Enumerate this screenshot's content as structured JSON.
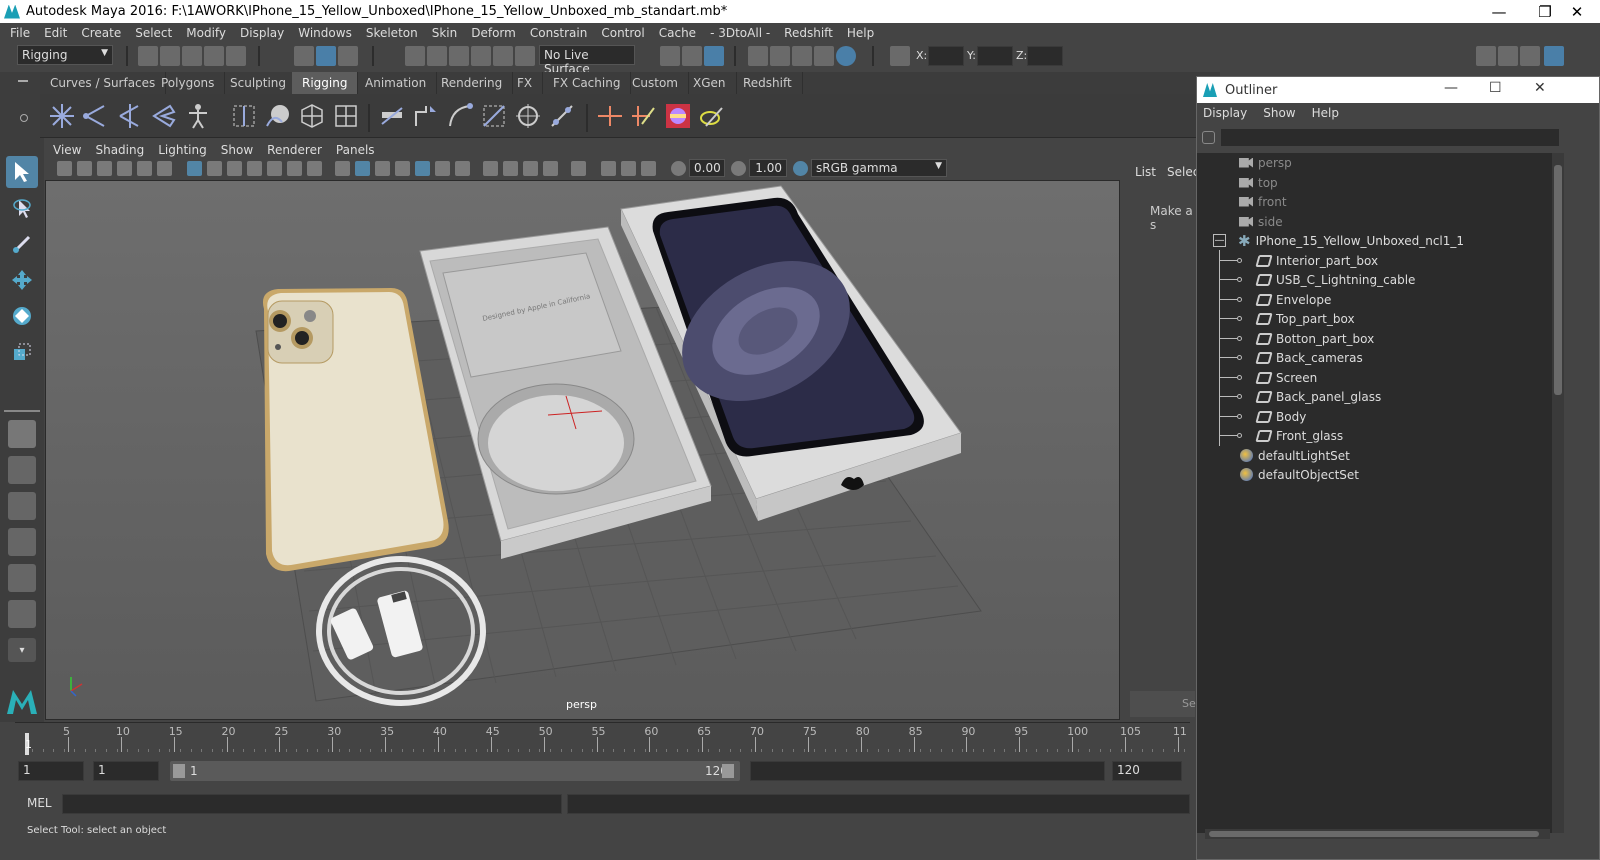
{
  "window": {
    "title": "Autodesk Maya 2016: F:\\1AWORK\\IPhone_15_Yellow_Unboxed\\IPhone_15_Yellow_Unboxed_mb_standart.mb*"
  },
  "menubar": {
    "items": [
      "File",
      "Edit",
      "Create",
      "Select",
      "Modify",
      "Display",
      "Windows",
      "Skeleton",
      "Skin",
      "Deform",
      "Constrain",
      "Control",
      "Cache",
      "- 3DtoAll -",
      "Redshift",
      "Help"
    ]
  },
  "statusline": {
    "menuset": "Rigging",
    "live_surface": "No Live Surface",
    "x_label": "X:",
    "y_label": "Y:",
    "z_label": "Z:"
  },
  "shelf": {
    "tabs": [
      "Curves / Surfaces",
      "Polygons",
      "Sculpting",
      "Rigging",
      "Animation",
      "Rendering",
      "FX",
      "FX Caching",
      "Custom",
      "XGen",
      "Redshift"
    ],
    "active": "Rigging"
  },
  "viewport": {
    "menu": [
      "View",
      "Shading",
      "Lighting",
      "Show",
      "Renderer",
      "Panels"
    ],
    "near_value": "0.00",
    "gamma_value": "1.00",
    "color_space": "sRGB gamma",
    "camera_label": "persp",
    "box_text": "Designed by Apple in California"
  },
  "channelbox": {
    "tab_list": "List",
    "tab_select": "Selec",
    "make_text": "Make a s",
    "se_text": "Se"
  },
  "outliner": {
    "title": "Outliner",
    "menu": [
      "Display",
      "Show",
      "Help"
    ],
    "cameras": [
      "persp",
      "top",
      "front",
      "side"
    ],
    "group": "IPhone_15_Yellow_Unboxed_ncl1_1",
    "children": [
      "Interior_part_box",
      "USB_C_Lightning_cable",
      "Envelope",
      "Top_part_box",
      "Botton_part_box",
      "Back_cameras",
      "Screen",
      "Back_panel_glass",
      "Body",
      "Front_glass"
    ],
    "sets": [
      "defaultLightSet",
      "defaultObjectSet"
    ]
  },
  "timeline": {
    "ticks": [
      "5",
      "10",
      "15",
      "20",
      "25",
      "30",
      "35",
      "40",
      "45",
      "50",
      "55",
      "60",
      "65",
      "70",
      "75",
      "80",
      "85",
      "90",
      "95",
      "100",
      "105",
      "11"
    ],
    "current": "1"
  },
  "range": {
    "start": "1",
    "playstart": "1",
    "slider_start": "1",
    "slider_end": "120",
    "end": "120"
  },
  "mel": {
    "label": "MEL"
  },
  "help": {
    "text": "Select Tool: select an object"
  },
  "colors": {
    "accent": "#5285a6",
    "bg": "#444444",
    "dark": "#2b2b2b"
  }
}
